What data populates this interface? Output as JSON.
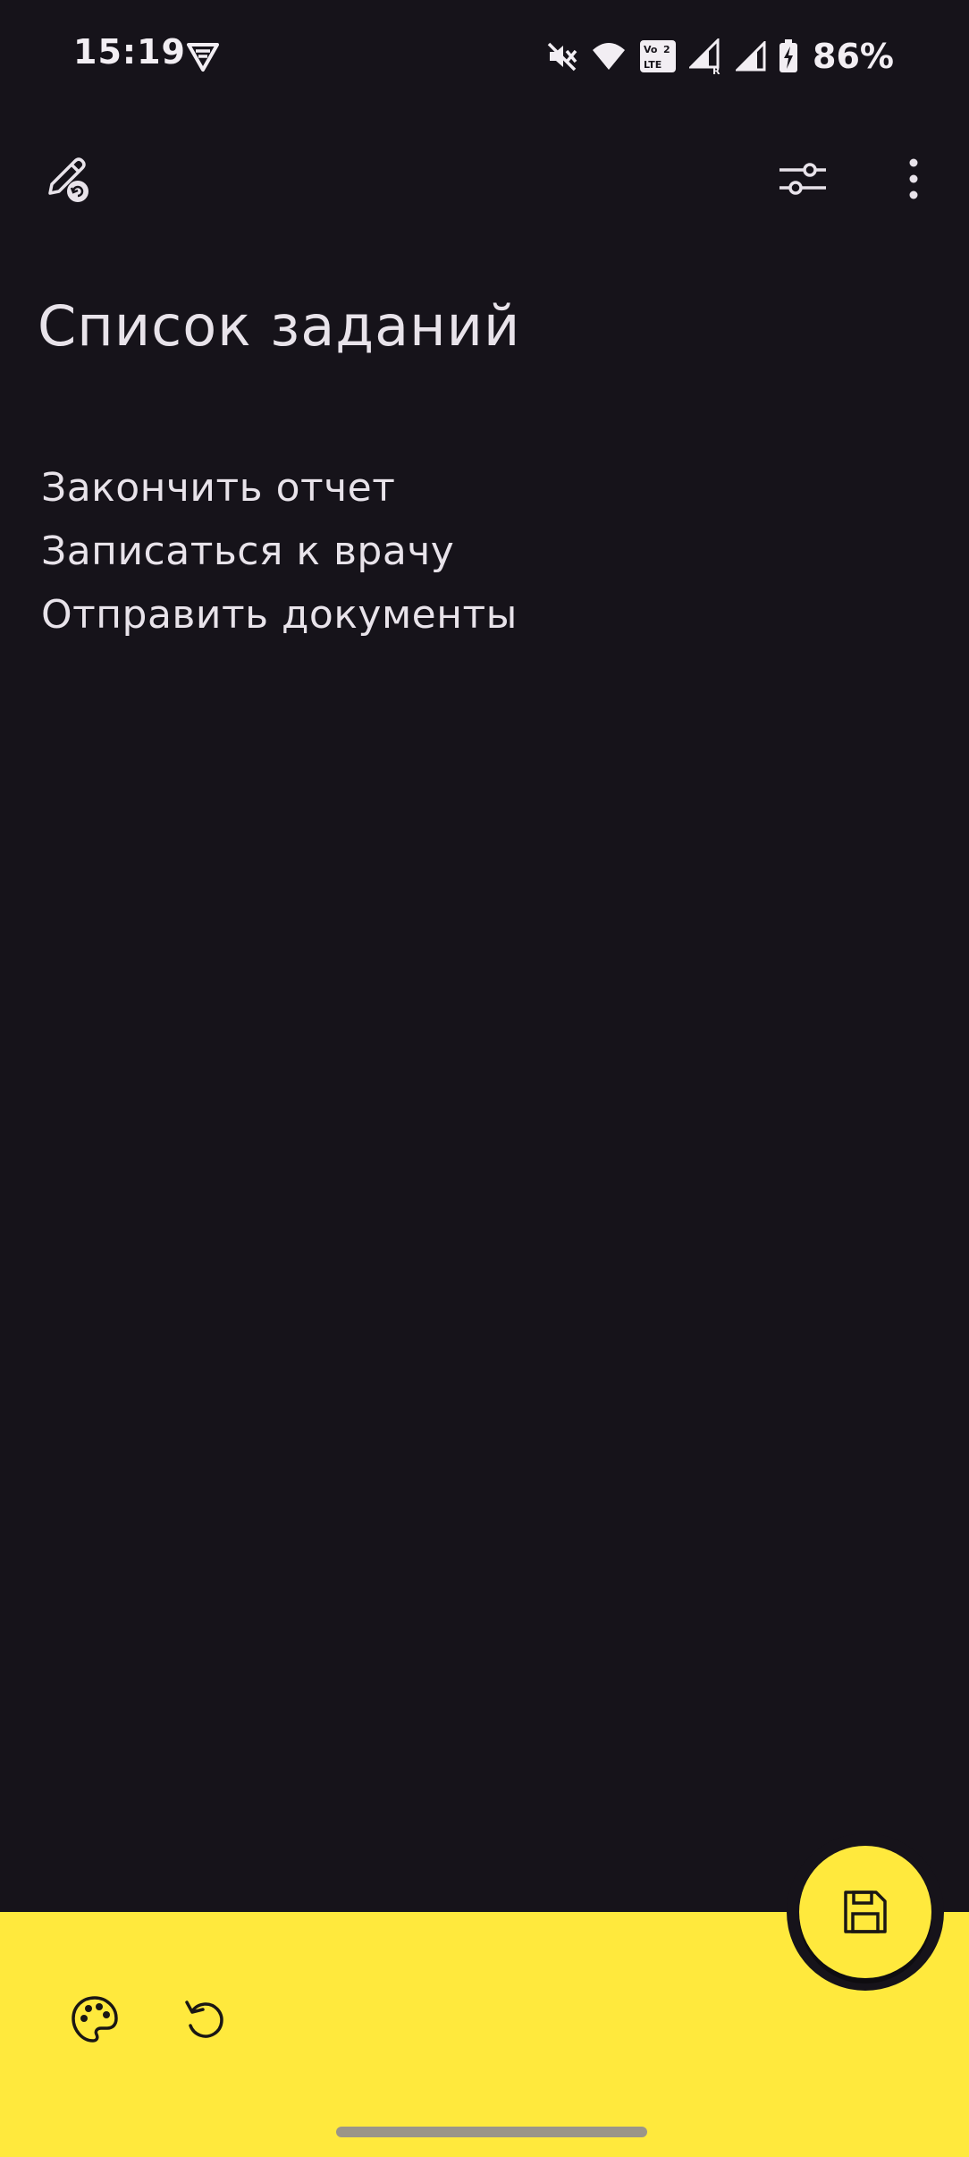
{
  "status_bar": {
    "time": "15:19",
    "battery": "86%",
    "icons": [
      "vpn-icon",
      "mute-icon",
      "wifi-icon",
      "volte-icon",
      "signal-roaming-icon",
      "signal-icon",
      "battery-charging-icon"
    ]
  },
  "toolbar": {
    "left_icon": "pen-undo-icon",
    "right_icons": [
      "sliders-icon",
      "more-vert-icon"
    ]
  },
  "note": {
    "title": "Список заданий",
    "lines": [
      "Закончить отчет",
      "Записаться к врачу",
      "Отправить документы"
    ]
  },
  "bottom_bar": {
    "icons": [
      "palette-icon",
      "undo-icon"
    ],
    "fab_icon": "save-icon"
  },
  "colors": {
    "background": "#16131a",
    "accent": "#ffe93d",
    "text": "#e8e3ea"
  }
}
